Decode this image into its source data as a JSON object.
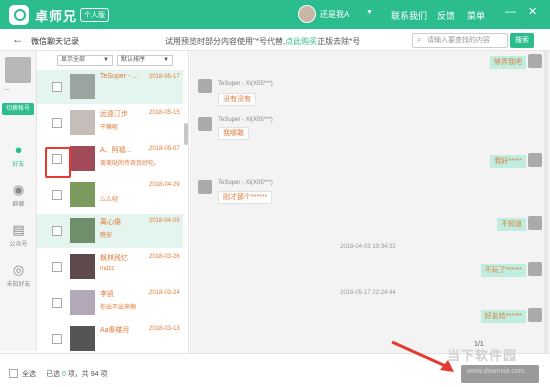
{
  "app": {
    "title": "卓师兄",
    "badge": "个人版"
  },
  "titlebar": {
    "user_name": "还是我A",
    "nav": [
      "联系我们",
      "反馈",
      "菜单"
    ],
    "win_controls": [
      "—",
      "✕"
    ]
  },
  "subheader": {
    "title": "微信聊天记录",
    "notice_prefix": "试用预览时部分内容使用\"*号代替,",
    "notice_link": "点此购买",
    "notice_suffix": "正版去除*号",
    "search_placeholder": "请输入要查找的内容",
    "search_button": "搜索"
  },
  "sidebar": {
    "account_name": "…",
    "switch_button": "切换帐号",
    "nav": [
      {
        "label": "好友",
        "icon": "person-icon",
        "active": true
      },
      {
        "label": "群聊",
        "icon": "group-icon",
        "active": false
      },
      {
        "label": "公众号",
        "icon": "article-icon",
        "active": false
      },
      {
        "label": "未知好友",
        "icon": "unknown-user-icon",
        "active": false
      }
    ]
  },
  "filters": {
    "scope": "显示全部",
    "sort": "默认排序"
  },
  "contacts": [
    {
      "name": "TeSuper - ...",
      "date": "2018-05-17",
      "msg": "",
      "selected": true
    },
    {
      "name": "远遠汀步",
      "date": "2018-05-15",
      "msg": "干嘛呢",
      "selected": false
    },
    {
      "name": "A、阿福...",
      "date": "2018-05-07",
      "msg": "美美哒的传奇页好吃。",
      "selected": false
    },
    {
      "name": "",
      "date": "2018-04-29",
      "msg": "么么哒",
      "selected": false
    },
    {
      "name": "离心傷",
      "date": "2018-04-05",
      "msg": "晚安",
      "selected": true
    },
    {
      "name": "枫林残忆",
      "date": "2018-03-26",
      "msg": "mdzz",
      "selected": false
    },
    {
      "name": "李凯",
      "date": "2018-03-24",
      "msg": "你出不出来啊",
      "selected": false
    },
    {
      "name": "Aa秦楼月",
      "date": "2018-03-13",
      "msg": "",
      "selected": false
    }
  ],
  "chat": {
    "nickname": "TeSuper - Xi(X05***)",
    "messages": [
      {
        "side": "right",
        "text": "够弄我吧"
      },
      {
        "side": "left",
        "text": "没有没有"
      },
      {
        "side": "left",
        "text": "我哪敢"
      },
      {
        "side": "right",
        "text": "我好*****"
      },
      {
        "side": "left",
        "text": "刚才那个******"
      },
      {
        "side": "right",
        "text": "不知道"
      },
      {
        "side": "ts",
        "text": "2018-04-03 19:34:32"
      },
      {
        "side": "right",
        "text": "不玩了******"
      },
      {
        "side": "ts",
        "text": "2018-05-17 22:24:44"
      },
      {
        "side": "right",
        "text": "好友给******"
      }
    ],
    "pager": "1/1"
  },
  "footer": {
    "select_all": "全选",
    "selected_prefix": "已选",
    "selected_count": "0",
    "selected_mid": "项，共",
    "total_count": "94",
    "total_suffix": "项"
  },
  "watermark": {
    "text": "当下软件园",
    "url": "www.downxia.com"
  },
  "colors": {
    "accent": "#2bbd8e",
    "message_text": "#e07b39",
    "highlight": "#e63a2e"
  }
}
